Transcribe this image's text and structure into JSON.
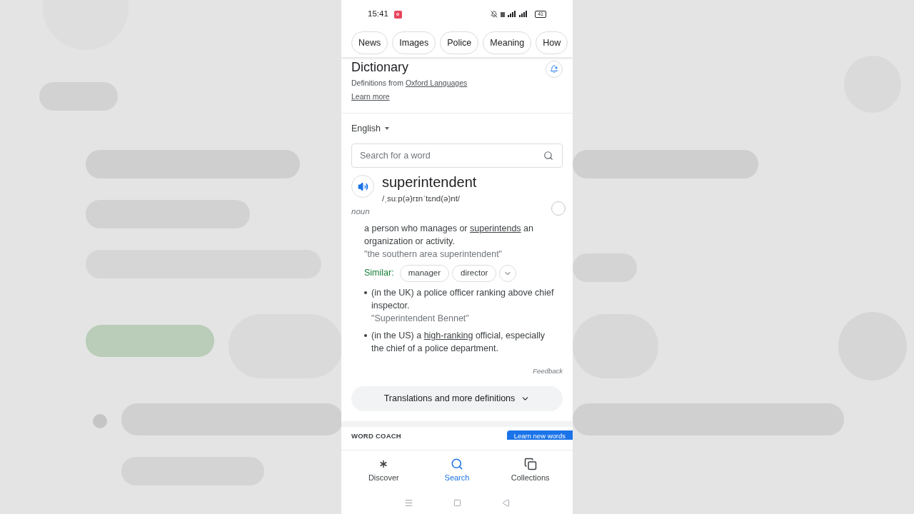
{
  "status_bar": {
    "time": "15:41",
    "battery": "41"
  },
  "chips": [
    {
      "label": "News"
    },
    {
      "label": "Images"
    },
    {
      "label": "Police"
    },
    {
      "label": "Meaning"
    },
    {
      "label": "How"
    }
  ],
  "dictionary": {
    "title": "Dictionary",
    "source_prefix": "Definitions from",
    "source_link": "Oxford Languages",
    "learn_more": "Learn more",
    "language": "English",
    "search": {
      "placeholder": "Search for a word"
    },
    "word": "superintendent",
    "phonetic": "/ˌsuːp(ə)rɪnˈtɛnd(ə)nt/",
    "part_of_speech": "noun",
    "senses": [
      {
        "kind": "main",
        "before": "a person who manages or ",
        "link": "superintends",
        "after": " an organization or activity.",
        "example": "\"the southern area superintendent\""
      },
      {
        "kind": "similar",
        "label": "Similar:",
        "words": [
          "manager",
          "director"
        ]
      },
      {
        "kind": "bullet",
        "before": "(in the UK) a police officer ranking above chief inspector.",
        "example": "\"Superintendent Bennet\""
      },
      {
        "kind": "bullet",
        "before": "(in the US) a ",
        "link": "high-ranking",
        "after": " official, especially the chief of a police department."
      }
    ],
    "feedback": "Feedback",
    "more_button": "Translations and more definitions"
  },
  "word_coach": {
    "title": "WORD COACH",
    "button": "Learn new words"
  },
  "bottom_nav": [
    {
      "label": "Discover",
      "selected": false
    },
    {
      "label": "Search",
      "selected": true
    },
    {
      "label": "Collections",
      "selected": false
    }
  ]
}
